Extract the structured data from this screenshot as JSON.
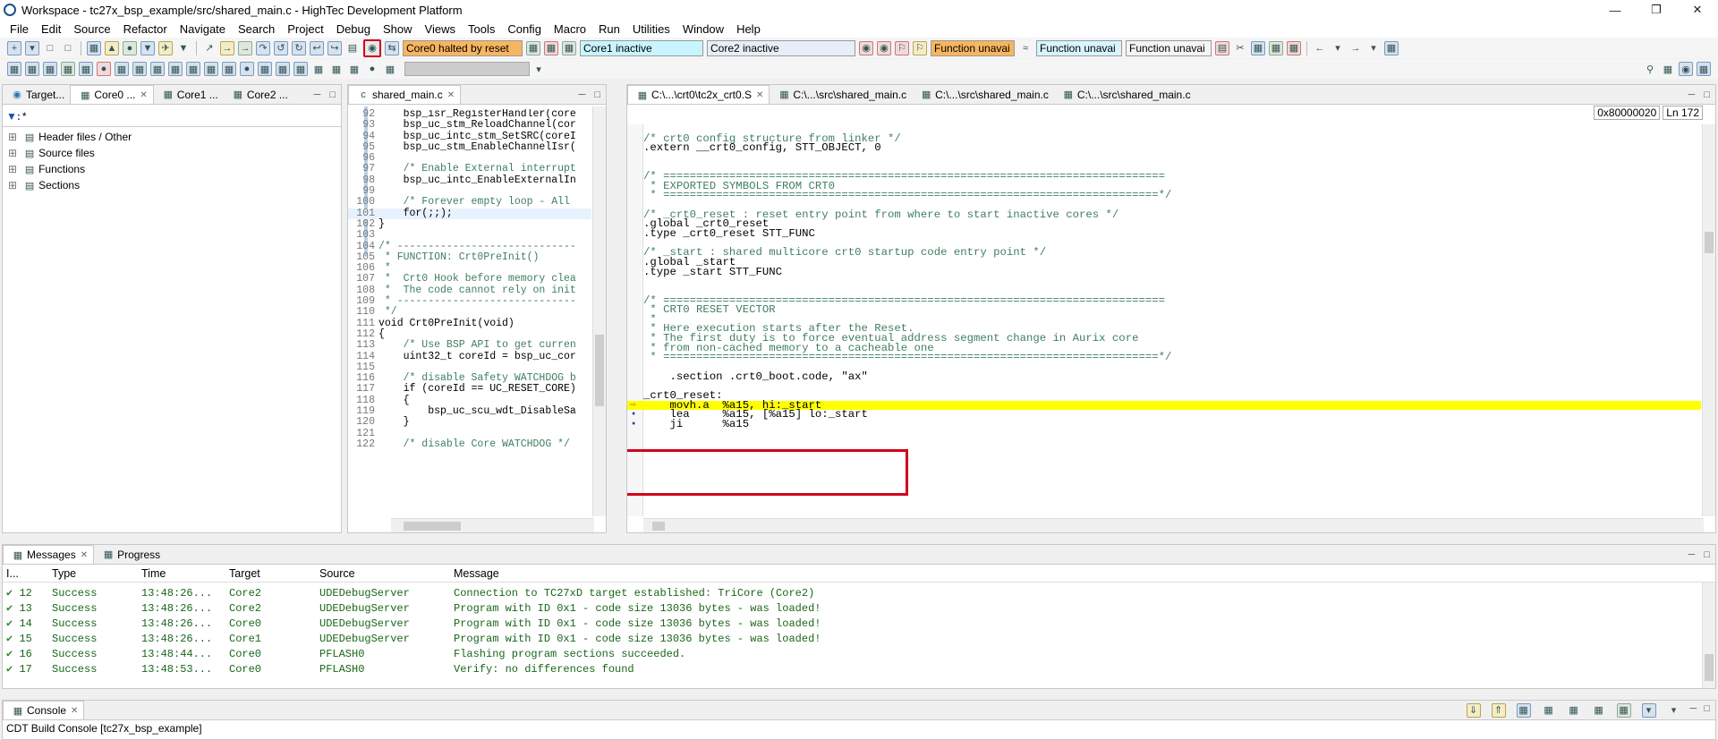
{
  "window": {
    "title": "Workspace - tc27x_bsp_example/src/shared_main.c - HighTec Development Platform"
  },
  "menu": [
    "File",
    "Edit",
    "Source",
    "Refactor",
    "Navigate",
    "Search",
    "Project",
    "Debug",
    "Show",
    "Views",
    "Tools",
    "Config",
    "Macro",
    "Run",
    "Utilities",
    "Window",
    "Help"
  ],
  "toolbar": {
    "core0_status": "Core0 halted by reset",
    "core1_status": "Core1 inactive",
    "core2_status": "Core2 inactive",
    "func1": "Function unavai",
    "func2": "Function unavai",
    "func3": "Function unavai"
  },
  "left_panel": {
    "tabs": [
      "Target...",
      "Core0 ...",
      "Core1 ...",
      "Core2 ..."
    ],
    "filter": "*",
    "tree": [
      "Header files / Other",
      "Source files",
      "Functions",
      "Sections"
    ]
  },
  "editor": {
    "tab": "shared_main.c",
    "lines": [
      {
        "n": "92",
        "t": "    bsp_isr_RegisterHandler(core"
      },
      {
        "n": "93",
        "t": "    bsp_uc_stm_ReloadChannel(cor"
      },
      {
        "n": "94",
        "t": "    bsp_uc_intc_stm_SetSRC(coreI"
      },
      {
        "n": "95",
        "t": "    bsp_uc_stm_EnableChannelIsr("
      },
      {
        "n": "96",
        "t": ""
      },
      {
        "n": "97",
        "t": "    /* Enable External interrupt"
      },
      {
        "n": "98",
        "t": "    bsp_uc_intc_EnableExternalIn"
      },
      {
        "n": "99",
        "t": ""
      },
      {
        "n": "100",
        "t": "    /* Forever empty loop - All"
      },
      {
        "n": "101",
        "t": "    for(;;);"
      },
      {
        "n": "102",
        "t": "}"
      },
      {
        "n": "103",
        "t": ""
      },
      {
        "n": "104",
        "t": "/* -----------------------------"
      },
      {
        "n": "105",
        "t": " * FUNCTION: Crt0PreInit()"
      },
      {
        "n": "106",
        "t": " *"
      },
      {
        "n": "107",
        "t": " *  Crt0 Hook before memory clea"
      },
      {
        "n": "108",
        "t": " *  The code cannot rely on init"
      },
      {
        "n": "109",
        "t": " * -----------------------------"
      },
      {
        "n": "110",
        "t": " */"
      },
      {
        "n": "111",
        "t": "void Crt0PreInit(void)"
      },
      {
        "n": "112",
        "t": "{"
      },
      {
        "n": "113",
        "t": "    /* Use BSP API to get curren"
      },
      {
        "n": "114",
        "t": "    uint32_t coreId = bsp_uc_cor"
      },
      {
        "n": "115",
        "t": ""
      },
      {
        "n": "116",
        "t": "    /* disable Safety WATCHDOG b"
      },
      {
        "n": "117",
        "t": "    if (coreId == UC_RESET_CORE)"
      },
      {
        "n": "118",
        "t": "    {"
      },
      {
        "n": "119",
        "t": "        bsp_uc_scu_wdt_DisableSa"
      },
      {
        "n": "120",
        "t": "    }"
      },
      {
        "n": "121",
        "t": ""
      },
      {
        "n": "122",
        "t": "    /* disable Core WATCHDOG */"
      }
    ]
  },
  "disasm": {
    "tabs": [
      "C:\\...\\crt0\\tc2x_crt0.S",
      "C:\\...\\src\\shared_main.c",
      "C:\\...\\src\\shared_main.c",
      "C:\\...\\src\\shared_main.c"
    ],
    "address": "0x80000020",
    "line": "Ln 172",
    "lines": [
      "",
      "/* crt0 config structure from linker */",
      ".extern __crt0_config, STT_OBJECT, 0",
      "",
      "",
      "/* ============================================================================",
      " * EXPORTED SYMBOLS FROM CRT0",
      " * ===========================================================================*/",
      "",
      "/* _crt0_reset : reset entry point from where to start inactive cores */",
      ".global _crt0_reset",
      ".type _crt0_reset STT_FUNC",
      "",
      "/* _start : shared multicore crt0 startup code entry point */",
      ".global _start",
      ".type _start STT_FUNC",
      "",
      "",
      "/* ============================================================================",
      " * CRT0 RESET VECTOR",
      " *",
      " * Here execution starts after the Reset.",
      " * The first duty is to force eventual address segment change in Aurix core",
      " * from non-cached memory to a cacheable one",
      " * ===========================================================================*/",
      "",
      "    .section .crt0_boot.code, \"ax\"",
      "",
      "_crt0_reset:",
      "    movh.a  %a15, hi:_start",
      "    lea     %a15, [%a15] lo:_start",
      "    ji      %a15"
    ]
  },
  "messages": {
    "tabs": [
      "Messages",
      "Progress"
    ],
    "headers": [
      "I...",
      "Type",
      "Time",
      "Target",
      "Source",
      "Message"
    ],
    "rows": [
      {
        "id": "12",
        "type": "Success",
        "time": "13:48:26...",
        "target": "Core2",
        "source": "UDEDebugServer",
        "message": "Connection to TC27xD target established: TriCore (Core2)"
      },
      {
        "id": "13",
        "type": "Success",
        "time": "13:48:26...",
        "target": "Core2",
        "source": "UDEDebugServer",
        "message": "Program with ID 0x1 - code size 13036 bytes - was loaded!"
      },
      {
        "id": "14",
        "type": "Success",
        "time": "13:48:26...",
        "target": "Core0",
        "source": "UDEDebugServer",
        "message": "Program with ID 0x1 - code size 13036 bytes - was loaded!"
      },
      {
        "id": "15",
        "type": "Success",
        "time": "13:48:26...",
        "target": "Core1",
        "source": "UDEDebugServer",
        "message": "Program with ID 0x1 - code size 13036 bytes - was loaded!"
      },
      {
        "id": "16",
        "type": "Success",
        "time": "13:48:44...",
        "target": "Core0",
        "source": "PFLASH0",
        "message": "Flashing program sections succeeded."
      },
      {
        "id": "17",
        "type": "Success",
        "time": "13:48:53...",
        "target": "Core0",
        "source": "PFLASH0",
        "message": "Verify: no differences found"
      }
    ]
  },
  "console": {
    "tab": "Console",
    "text": "CDT Build Console [tc27x_bsp_example]"
  },
  "colors": {
    "highlight": "#ffff00",
    "annotation": "#d0021b",
    "core0": "#f7b560",
    "core1": "#c8f4ff",
    "core2": "#e8eef8",
    "func": "#f7b560",
    "func2": "#d8f4ff"
  }
}
